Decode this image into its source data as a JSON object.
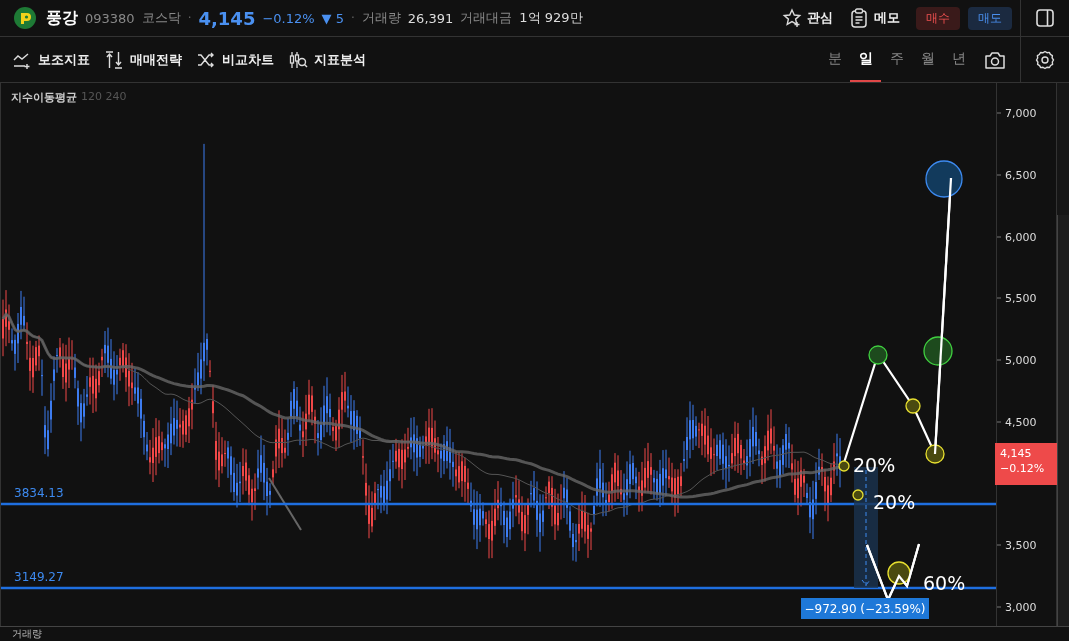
{
  "header": {
    "name": "풍강",
    "code": "093380",
    "market": "코스닥",
    "separators": [
      "·",
      "·"
    ],
    "price": "4,145",
    "change_rate": "−0.12%",
    "change_arrow": "▼",
    "change": "5",
    "volume_label": "거래량",
    "volume": "26,391",
    "amount_label": "거래대금",
    "amount": "1억 929만",
    "actions": [
      {
        "kind": "watch",
        "label": "관심"
      },
      {
        "kind": "memo",
        "label": "메모"
      }
    ],
    "trade_buttons": [
      {
        "kind": "buy",
        "label": "매수"
      },
      {
        "kind": "sell",
        "label": "매도"
      }
    ]
  },
  "toolbar": {
    "tools": [
      {
        "kind": "indicator",
        "label": "보조지표"
      },
      {
        "kind": "strategy",
        "label": "매매전략"
      },
      {
        "kind": "compare",
        "label": "비교차트"
      },
      {
        "kind": "analysis",
        "label": "지표분석"
      }
    ],
    "periods": [
      {
        "label": "분",
        "selected": false
      },
      {
        "label": "일",
        "selected": true
      },
      {
        "label": "주",
        "selected": false
      },
      {
        "label": "월",
        "selected": false
      },
      {
        "label": "년",
        "selected": false
      }
    ]
  },
  "chart": {
    "legend": {
      "name": "지수이동평균",
      "params": "120 240"
    },
    "y_axis_labels": [
      "7,000",
      "6,500",
      "6,000",
      "5,500",
      "5,000",
      "4,500",
      "3,500",
      "3,000"
    ],
    "levels": [
      {
        "label": "3834.13"
      },
      {
        "label": "3149.27"
      }
    ],
    "percent_labels": [
      "20%",
      "20%",
      "60%"
    ],
    "measure": "−972.90 (−23.59%)",
    "price_tag": {
      "price": "4,145",
      "change": "−0.12%"
    }
  },
  "volume_pane": {
    "title": "거래량"
  }
}
